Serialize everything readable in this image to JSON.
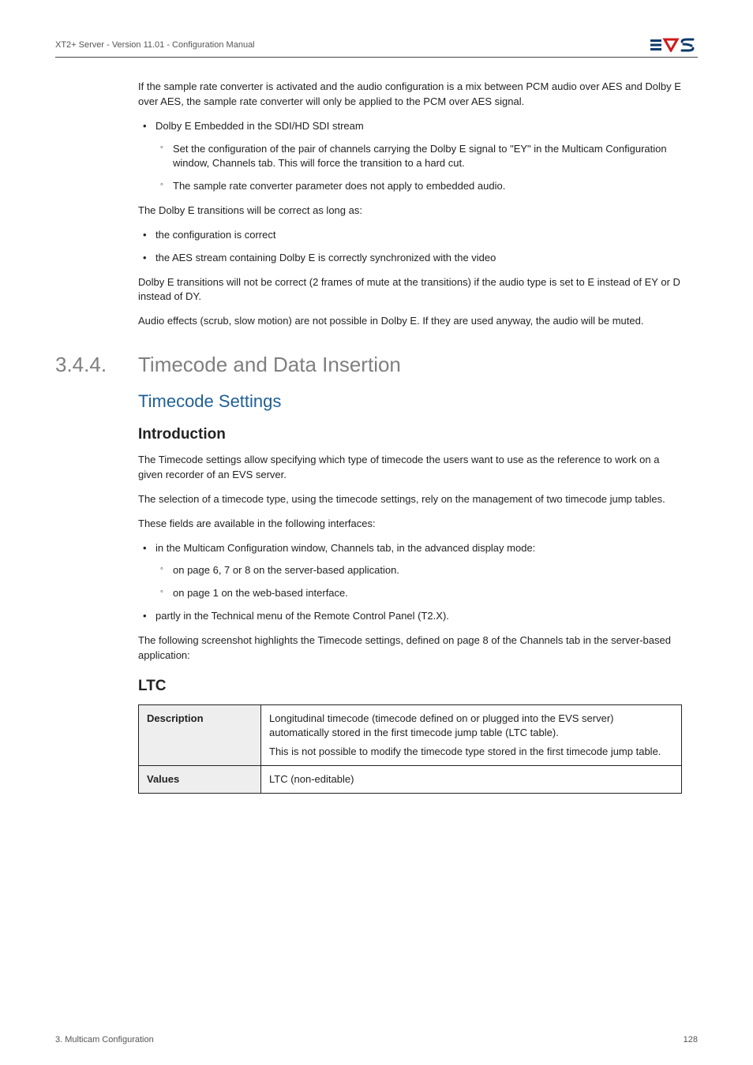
{
  "header": {
    "left": "XT2+ Server - Version 11.01 - Configuration Manual"
  },
  "intro": {
    "p1": "If the sample rate converter is activated and the audio configuration is a mix between PCM audio over AES and Dolby E over AES, the sample rate converter will only be applied to the PCM over AES signal.",
    "b1": "Dolby E Embedded in the SDI/HD SDI stream",
    "b1s1": "Set the configuration of the pair of channels carrying the Dolby E signal to \"EY\" in the Multicam Configuration window, Channels tab. This will force the transition to a hard cut.",
    "b1s2": "The sample rate converter parameter does not apply to embedded audio.",
    "p2": "The Dolby E transitions will be correct as long as:",
    "b2": "the configuration is correct",
    "b3": "the AES stream containing Dolby E is correctly synchronized with the video",
    "p3": "Dolby E transitions will not be correct (2 frames of mute at the transitions) if the audio type is set to E instead of EY or D instead of DY.",
    "p4": "Audio effects (scrub, slow motion) are not possible in Dolby E. If they are used anyway, the audio will be muted."
  },
  "section": {
    "number": "3.4.4.",
    "title": "Timecode and Data Insertion"
  },
  "h2_timecode": "Timecode Settings",
  "h3_intro": "Introduction",
  "intro2": {
    "p1": "The Timecode settings allow specifying which type of timecode the users want to use as the reference to work on a given recorder of an EVS server.",
    "p2": "The selection of a timecode type, using the timecode settings, rely on the management of two timecode jump tables.",
    "p3": "These fields are available in the following interfaces:",
    "b1": "in the Multicam Configuration window, Channels tab, in the advanced display mode:",
    "b1s1": "on page 6, 7 or 8 on the server-based application.",
    "b1s2": "on page 1 on the web-based interface.",
    "b2": "partly in the Technical menu of the Remote Control Panel (T2.X).",
    "p4": "The following screenshot highlights the Timecode settings, defined on page 8 of the Channels tab in the server-based application:"
  },
  "h3_ltc": "LTC",
  "table": {
    "r1_label": "Description",
    "r1_val_p1": "Longitudinal timecode (timecode defined on or plugged into the EVS server) automatically stored in the first timecode jump table (LTC table).",
    "r1_val_p2": "This is not possible to modify the timecode type stored in the first timecode jump table.",
    "r2_label": "Values",
    "r2_val": "LTC (non-editable)"
  },
  "footer": {
    "left": "3. Multicam Configuration",
    "right": "128"
  }
}
